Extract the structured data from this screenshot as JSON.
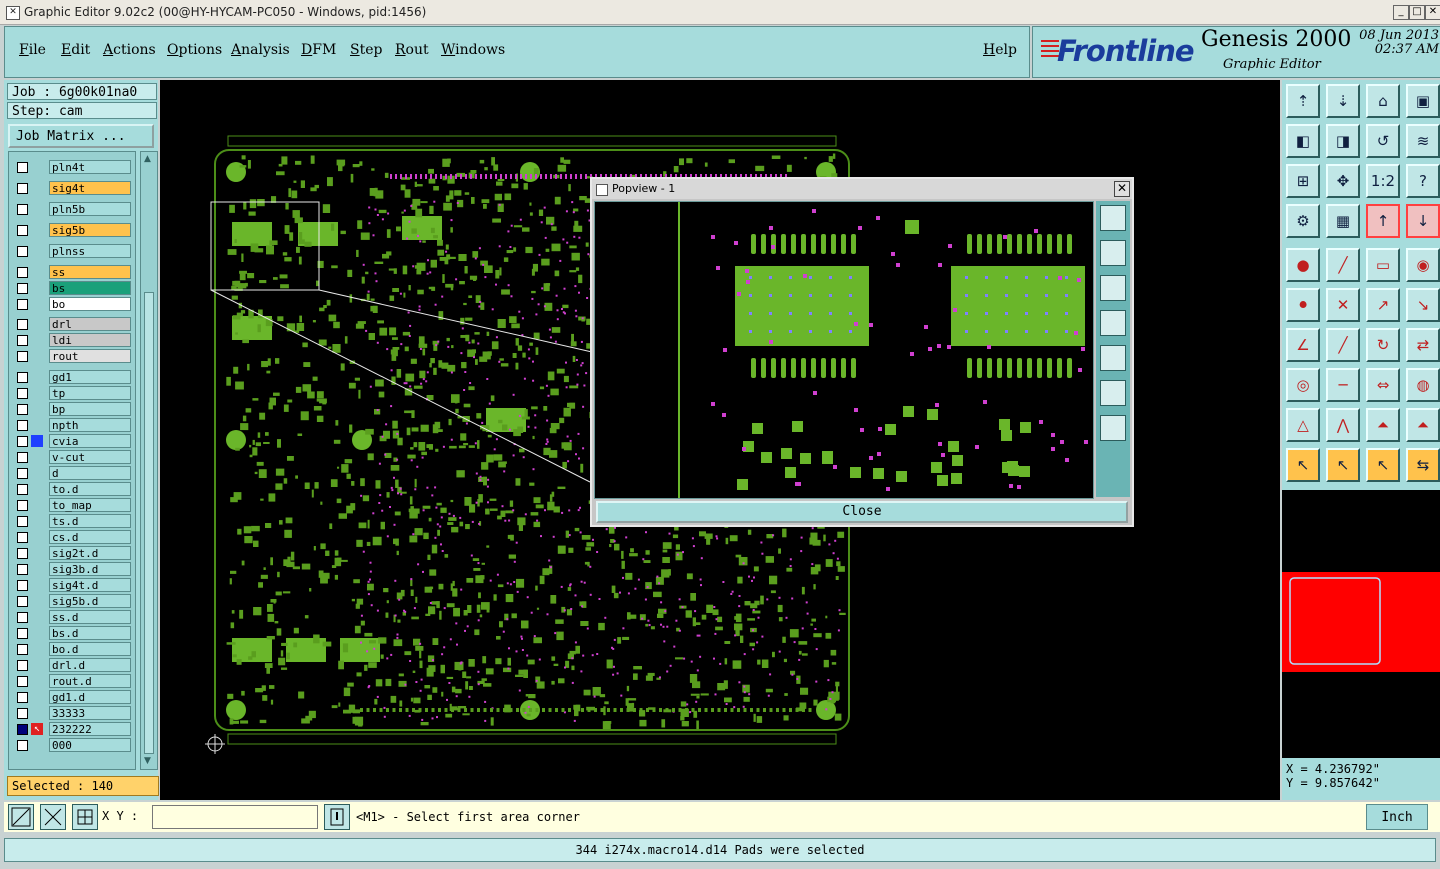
{
  "window": {
    "title": "Graphic Editor 9.02c2 (00@HY-HYCAM-PC050 - Windows, pid:1456)",
    "minimize": "_",
    "maximize": "□",
    "close": "✕"
  },
  "menu": {
    "items": [
      "File",
      "Edit",
      "Actions",
      "Options",
      "Analysis",
      "DFM",
      "Step",
      "Rout",
      "Windows"
    ],
    "help": "Help"
  },
  "brand": {
    "logo": "Frontline",
    "product": "Genesis 2000",
    "subtitle": "Graphic Editor",
    "date": "08 Jun 2013",
    "time": "02:37 AM"
  },
  "job": {
    "job_label": "Job : 6g00k01na0",
    "step_label": "Step: cam",
    "matrix_button": "Job Matrix ..."
  },
  "layers": [
    {
      "name": "pln4t",
      "color": "#a6dcdc"
    },
    {
      "name": "sig4t",
      "color": "#ffc24c"
    },
    {
      "name": "pln5b",
      "color": "#a6dcdc"
    },
    {
      "name": "sig5b",
      "color": "#ffc24c"
    },
    {
      "name": "plnss",
      "color": "#a6dcdc"
    },
    {
      "name": "ss",
      "color": "#ffc24c"
    },
    {
      "name": "bs",
      "color": "#1aa07a"
    },
    {
      "name": "bo",
      "color": "#ffffff"
    },
    {
      "name": "drl",
      "color": "#c8c8c8"
    },
    {
      "name": "ldi",
      "color": "#c8c8c8"
    },
    {
      "name": "rout",
      "color": "#e0e0e0"
    },
    {
      "name": "gd1",
      "color": "#a6dcdc"
    },
    {
      "name": "tp",
      "color": "#a6dcdc"
    },
    {
      "name": "bp",
      "color": "#a6dcdc"
    },
    {
      "name": "npth",
      "color": "#a6dcdc"
    },
    {
      "name": "cvia",
      "color": "#a6dcdc"
    },
    {
      "name": "v-cut",
      "color": "#a6dcdc"
    },
    {
      "name": "d",
      "color": "#a6dcdc"
    },
    {
      "name": "to.d",
      "color": "#a6dcdc"
    },
    {
      "name": "to_map",
      "color": "#a6dcdc"
    },
    {
      "name": "ts.d",
      "color": "#a6dcdc"
    },
    {
      "name": "cs.d",
      "color": "#a6dcdc"
    },
    {
      "name": "sig2t.d",
      "color": "#a6dcdc"
    },
    {
      "name": "sig3b.d",
      "color": "#a6dcdc"
    },
    {
      "name": "sig4t.d",
      "color": "#a6dcdc"
    },
    {
      "name": "sig5b.d",
      "color": "#a6dcdc"
    },
    {
      "name": "ss.d",
      "color": "#a6dcdc"
    },
    {
      "name": "bs.d",
      "color": "#a6dcdc"
    },
    {
      "name": "bo.d",
      "color": "#a6dcdc"
    },
    {
      "name": "drl.d",
      "color": "#a6dcdc"
    },
    {
      "name": "rout.d",
      "color": "#a6dcdc"
    },
    {
      "name": "gd1.d",
      "color": "#a6dcdc"
    },
    {
      "name": "33333",
      "color": "#a6dcdc"
    },
    {
      "name": "232222",
      "color": "#a6dcdc"
    },
    {
      "name": "000",
      "color": "#a6dcdc"
    }
  ],
  "selected_label": "Selected : 140",
  "popview": {
    "title": "Popview - 1",
    "close_label": "Close",
    "close_x": "✕"
  },
  "coords": {
    "x": "X = 4.236792\"",
    "y": "Y = 9.857642\""
  },
  "bottom": {
    "xy_label": "X Y :",
    "xy_value": "",
    "prompt": "<M1> - Select first area corner",
    "unit": "Inch",
    "status": "344 i274x.macro14.d14 Pads were selected"
  },
  "colors": {
    "pcb_green": "#5a9e1e",
    "pad_green": "#6ab62a",
    "via_magenta": "#d040d0",
    "overview_red": "#ff0000",
    "panel_cyan": "#a6dcdc"
  }
}
